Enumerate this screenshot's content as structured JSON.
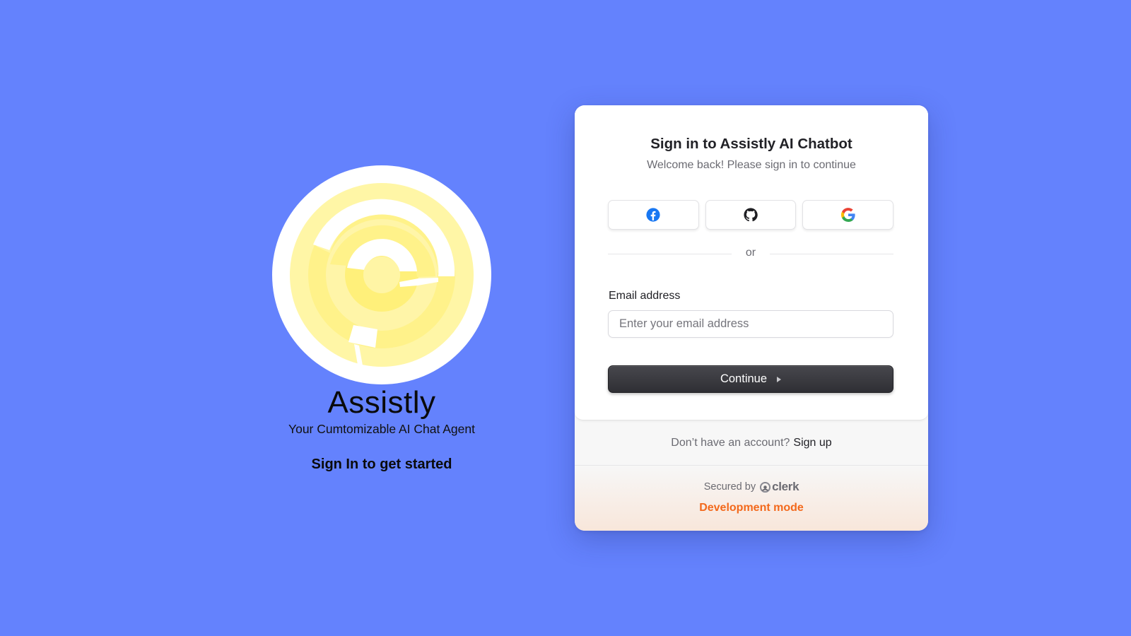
{
  "brand": {
    "logo_icon": "assistly-spiral-logo-icon",
    "name": "Assistly",
    "tagline": "Your Cumtomizable AI Chat Agent",
    "cta": "Sign In to get started"
  },
  "card": {
    "title": "Sign in to Assistly AI Chatbot",
    "subtitle": "Welcome back! Please sign in to continue",
    "social": [
      {
        "provider": "facebook",
        "icon": "facebook-icon"
      },
      {
        "provider": "github",
        "icon": "github-icon"
      },
      {
        "provider": "google",
        "icon": "google-icon"
      }
    ],
    "divider_text": "or",
    "email": {
      "label": "Email address",
      "value": "",
      "placeholder": "Enter your email address"
    },
    "continue_label": "Continue",
    "signup_prompt": "Don’t have an account?",
    "signup_link": "Sign up",
    "secured_by": "Secured by",
    "clerk_brand": "clerk",
    "dev_mode": "Development mode"
  },
  "colors": {
    "background": "#6482fd",
    "logo_yellow": "#fff17c",
    "dev_mode": "#f3691c",
    "button_dark": "#2f2f34"
  }
}
